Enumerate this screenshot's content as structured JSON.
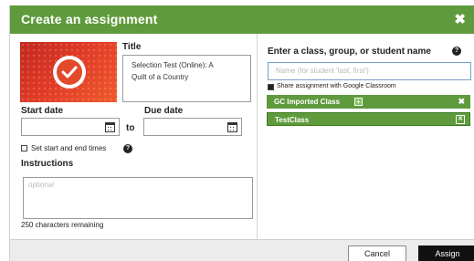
{
  "dialog": {
    "title": "Create an assignment",
    "close_glyph": "✖"
  },
  "left": {
    "thumbnail_icon": "checkmark-badge-icon",
    "title_label": "Title",
    "title_value_line1": "Selection Test (Online): A",
    "title_value_line2": "Quilt of a Country",
    "start_date_label": "Start date",
    "due_date_label": "Due date",
    "start_date_value": "",
    "due_date_value": "",
    "to_label": "to",
    "set_times_label": "Set start and end times",
    "instructions_label": "Instructions",
    "instructions_placeholder": "optional",
    "chars_remaining": "250 characters remaining"
  },
  "right": {
    "assign_to_label": "Enter a class, group, or student name",
    "name_placeholder": "Name (for student 'last, first')",
    "share_google_label": "Share assignment with Google Classroom",
    "share_google_checked": true,
    "selected": [
      {
        "label": "GC Imported Class",
        "remove_glyph": "✖"
      },
      {
        "label": "TestClass",
        "remove_glyph": "☒"
      }
    ]
  },
  "footer": {
    "cancel_label": "Cancel",
    "assign_label": "Assign"
  },
  "colors": {
    "header_green": "#5f9a3c",
    "chip_green": "#5f9a3c",
    "assign_button": "#111111",
    "thumbnail_red": "#e03a26"
  }
}
